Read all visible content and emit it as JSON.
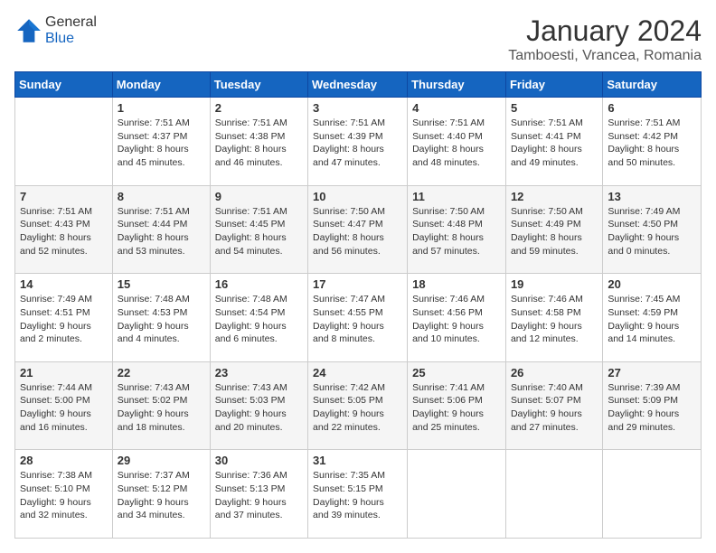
{
  "logo": {
    "general": "General",
    "blue": "Blue"
  },
  "header": {
    "month_year": "January 2024",
    "location": "Tamboesti, Vrancea, Romania"
  },
  "days_of_week": [
    "Sunday",
    "Monday",
    "Tuesday",
    "Wednesday",
    "Thursday",
    "Friday",
    "Saturday"
  ],
  "weeks": [
    [
      {
        "day": "",
        "info": ""
      },
      {
        "day": "1",
        "info": "Sunrise: 7:51 AM\nSunset: 4:37 PM\nDaylight: 8 hours\nand 45 minutes."
      },
      {
        "day": "2",
        "info": "Sunrise: 7:51 AM\nSunset: 4:38 PM\nDaylight: 8 hours\nand 46 minutes."
      },
      {
        "day": "3",
        "info": "Sunrise: 7:51 AM\nSunset: 4:39 PM\nDaylight: 8 hours\nand 47 minutes."
      },
      {
        "day": "4",
        "info": "Sunrise: 7:51 AM\nSunset: 4:40 PM\nDaylight: 8 hours\nand 48 minutes."
      },
      {
        "day": "5",
        "info": "Sunrise: 7:51 AM\nSunset: 4:41 PM\nDaylight: 8 hours\nand 49 minutes."
      },
      {
        "day": "6",
        "info": "Sunrise: 7:51 AM\nSunset: 4:42 PM\nDaylight: 8 hours\nand 50 minutes."
      }
    ],
    [
      {
        "day": "7",
        "info": "Sunrise: 7:51 AM\nSunset: 4:43 PM\nDaylight: 8 hours\nand 52 minutes."
      },
      {
        "day": "8",
        "info": "Sunrise: 7:51 AM\nSunset: 4:44 PM\nDaylight: 8 hours\nand 53 minutes."
      },
      {
        "day": "9",
        "info": "Sunrise: 7:51 AM\nSunset: 4:45 PM\nDaylight: 8 hours\nand 54 minutes."
      },
      {
        "day": "10",
        "info": "Sunrise: 7:50 AM\nSunset: 4:47 PM\nDaylight: 8 hours\nand 56 minutes."
      },
      {
        "day": "11",
        "info": "Sunrise: 7:50 AM\nSunset: 4:48 PM\nDaylight: 8 hours\nand 57 minutes."
      },
      {
        "day": "12",
        "info": "Sunrise: 7:50 AM\nSunset: 4:49 PM\nDaylight: 8 hours\nand 59 minutes."
      },
      {
        "day": "13",
        "info": "Sunrise: 7:49 AM\nSunset: 4:50 PM\nDaylight: 9 hours\nand 0 minutes."
      }
    ],
    [
      {
        "day": "14",
        "info": "Sunrise: 7:49 AM\nSunset: 4:51 PM\nDaylight: 9 hours\nand 2 minutes."
      },
      {
        "day": "15",
        "info": "Sunrise: 7:48 AM\nSunset: 4:53 PM\nDaylight: 9 hours\nand 4 minutes."
      },
      {
        "day": "16",
        "info": "Sunrise: 7:48 AM\nSunset: 4:54 PM\nDaylight: 9 hours\nand 6 minutes."
      },
      {
        "day": "17",
        "info": "Sunrise: 7:47 AM\nSunset: 4:55 PM\nDaylight: 9 hours\nand 8 minutes."
      },
      {
        "day": "18",
        "info": "Sunrise: 7:46 AM\nSunset: 4:56 PM\nDaylight: 9 hours\nand 10 minutes."
      },
      {
        "day": "19",
        "info": "Sunrise: 7:46 AM\nSunset: 4:58 PM\nDaylight: 9 hours\nand 12 minutes."
      },
      {
        "day": "20",
        "info": "Sunrise: 7:45 AM\nSunset: 4:59 PM\nDaylight: 9 hours\nand 14 minutes."
      }
    ],
    [
      {
        "day": "21",
        "info": "Sunrise: 7:44 AM\nSunset: 5:00 PM\nDaylight: 9 hours\nand 16 minutes."
      },
      {
        "day": "22",
        "info": "Sunrise: 7:43 AM\nSunset: 5:02 PM\nDaylight: 9 hours\nand 18 minutes."
      },
      {
        "day": "23",
        "info": "Sunrise: 7:43 AM\nSunset: 5:03 PM\nDaylight: 9 hours\nand 20 minutes."
      },
      {
        "day": "24",
        "info": "Sunrise: 7:42 AM\nSunset: 5:05 PM\nDaylight: 9 hours\nand 22 minutes."
      },
      {
        "day": "25",
        "info": "Sunrise: 7:41 AM\nSunset: 5:06 PM\nDaylight: 9 hours\nand 25 minutes."
      },
      {
        "day": "26",
        "info": "Sunrise: 7:40 AM\nSunset: 5:07 PM\nDaylight: 9 hours\nand 27 minutes."
      },
      {
        "day": "27",
        "info": "Sunrise: 7:39 AM\nSunset: 5:09 PM\nDaylight: 9 hours\nand 29 minutes."
      }
    ],
    [
      {
        "day": "28",
        "info": "Sunrise: 7:38 AM\nSunset: 5:10 PM\nDaylight: 9 hours\nand 32 minutes."
      },
      {
        "day": "29",
        "info": "Sunrise: 7:37 AM\nSunset: 5:12 PM\nDaylight: 9 hours\nand 34 minutes."
      },
      {
        "day": "30",
        "info": "Sunrise: 7:36 AM\nSunset: 5:13 PM\nDaylight: 9 hours\nand 37 minutes."
      },
      {
        "day": "31",
        "info": "Sunrise: 7:35 AM\nSunset: 5:15 PM\nDaylight: 9 hours\nand 39 minutes."
      },
      {
        "day": "",
        "info": ""
      },
      {
        "day": "",
        "info": ""
      },
      {
        "day": "",
        "info": ""
      }
    ]
  ]
}
